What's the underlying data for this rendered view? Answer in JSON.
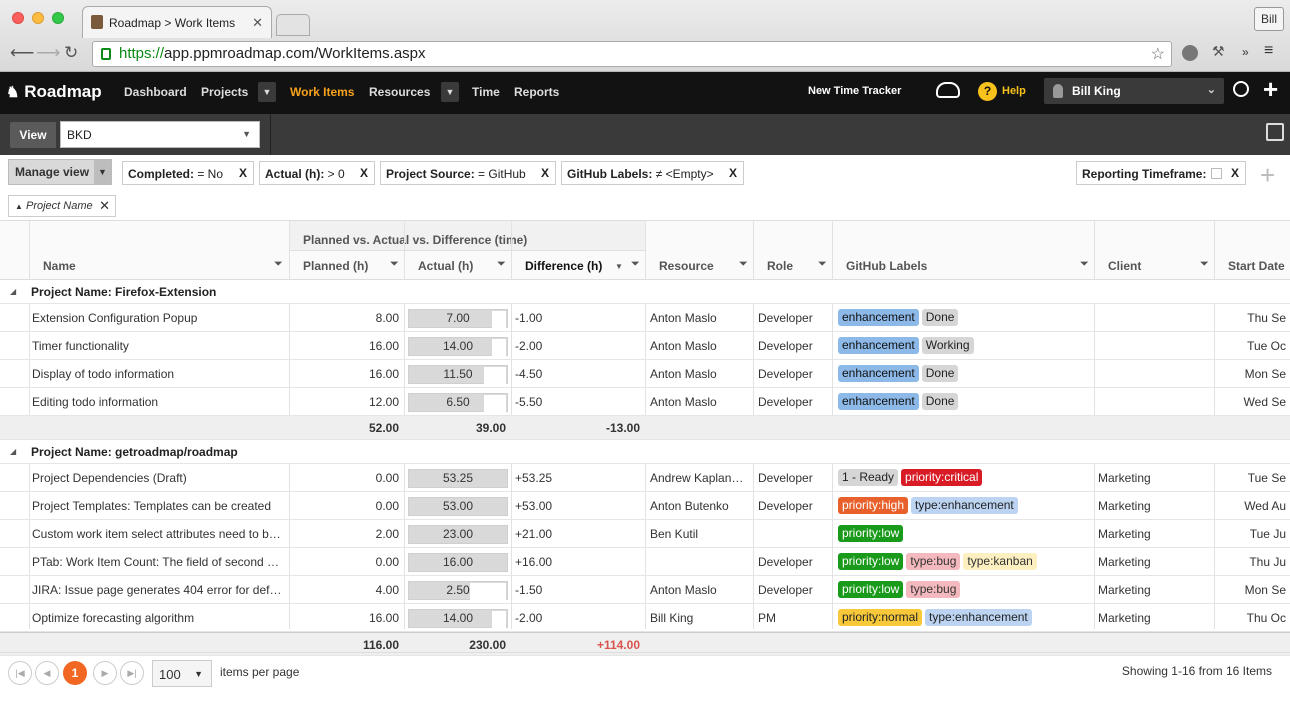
{
  "browser": {
    "tab_title": "Roadmap > Work Items",
    "url_scheme": "https://",
    "url_rest": "app.ppmroadmap.com/WorkItems.aspx",
    "profile": "Bill"
  },
  "nav": {
    "logo": "Roadmap",
    "items": [
      "Dashboard",
      "Projects",
      "Work Items",
      "Resources",
      "Time",
      "Reports"
    ],
    "active": "Work Items",
    "time_tracker": "New Time Tracker",
    "help": "Help",
    "user": "Bill King"
  },
  "view": {
    "label": "View",
    "selected": "BKD"
  },
  "filters": {
    "manage": "Manage view",
    "chips": [
      {
        "key": "Completed:",
        "val": " = No"
      },
      {
        "key": "Actual (h):",
        "val": " > 0"
      },
      {
        "key": "Project Source:",
        "val": " = GitHub"
      },
      {
        "key": "GitHub Labels:",
        "val": " ≠ <Empty>"
      }
    ],
    "reporting": "Reporting Timeframe:",
    "x": "X",
    "sort": "Project Name"
  },
  "grid": {
    "group_header": "Planned vs. Actual vs. Difference (time)",
    "columns": [
      "Name",
      "Planned (h)",
      "Actual (h)",
      "Difference (h)",
      "Resource",
      "Role",
      "GitHub Labels",
      "Client",
      "Start Date"
    ],
    "groups": [
      {
        "title": "Project Name: Firefox-Extension",
        "rows": [
          {
            "name": "Extension Configuration Popup",
            "planned": "8.00",
            "actual": "7.00",
            "actual_fill": 0.93,
            "diff": "-1.00",
            "resource": "Anton Maslo",
            "role": "Developer",
            "labels": [
              {
                "t": "enhancement",
                "c": "blue"
              },
              {
                "t": "Done",
                "c": "gray"
              }
            ],
            "client": "",
            "start": "Thu Se"
          },
          {
            "name": "Timer functionality",
            "planned": "16.00",
            "actual": "14.00",
            "actual_fill": 0.93,
            "diff": "-2.00",
            "resource": "Anton Maslo",
            "role": "Developer",
            "labels": [
              {
                "t": "enhancement",
                "c": "blue"
              },
              {
                "t": "Working",
                "c": "gray"
              }
            ],
            "client": "",
            "start": "Tue Oc"
          },
          {
            "name": "Display of todo information",
            "planned": "16.00",
            "actual": "11.50",
            "actual_fill": 0.78,
            "diff": "-4.50",
            "resource": "Anton Maslo",
            "role": "Developer",
            "labels": [
              {
                "t": "enhancement",
                "c": "blue"
              },
              {
                "t": "Done",
                "c": "gray"
              }
            ],
            "client": "",
            "start": "Mon Se"
          },
          {
            "name": "Editing todo information",
            "planned": "12.00",
            "actual": "6.50",
            "actual_fill": 0.78,
            "diff": "-5.50",
            "resource": "Anton Maslo",
            "role": "Developer",
            "labels": [
              {
                "t": "enhancement",
                "c": "blue"
              },
              {
                "t": "Done",
                "c": "gray"
              }
            ],
            "client": "",
            "start": "Wed Se"
          }
        ],
        "sum": {
          "planned": "52.00",
          "actual": "39.00",
          "diff": "-13.00"
        }
      },
      {
        "title": "Project Name: getroadmap/roadmap",
        "rows": [
          {
            "name": "Project Dependencies (Draft)",
            "planned": "0.00",
            "actual": "53.25",
            "actual_fill": 1,
            "diff": "+53.25",
            "resource": "Andrew Kaplan…",
            "role": "Developer",
            "labels": [
              {
                "t": "1 - Ready",
                "c": "gray"
              },
              {
                "t": "priority:critical",
                "c": "red"
              }
            ],
            "client": "Marketing",
            "start": "Tue Se"
          },
          {
            "name": "Project Templates: Templates can be created",
            "planned": "0.00",
            "actual": "53.00",
            "actual_fill": 1,
            "diff": "+53.00",
            "resource": "Anton Butenko",
            "role": "Developer",
            "labels": [
              {
                "t": "priority:high",
                "c": "orange"
              },
              {
                "t": "type:enhancement",
                "c": "lightblue"
              }
            ],
            "client": "Marketing",
            "start": "Wed Au"
          },
          {
            "name": "Custom work item select attributes need to b…",
            "planned": "2.00",
            "actual": "23.00",
            "actual_fill": 1,
            "diff": "+21.00",
            "resource": "Ben Kutil",
            "role": "",
            "labels": [
              {
                "t": "priority:low",
                "c": "green"
              }
            ],
            "client": "Marketing",
            "start": "Tue Ju"
          },
          {
            "name": "PTab: Work Item Count: The field of second …",
            "planned": "0.00",
            "actual": "16.00",
            "actual_fill": 1,
            "diff": "+16.00",
            "resource": "",
            "role": "Developer",
            "labels": [
              {
                "t": "priority:low",
                "c": "green"
              },
              {
                "t": "type:bug",
                "c": "pink"
              },
              {
                "t": "type:kanban",
                "c": "yellow"
              }
            ],
            "client": "Marketing",
            "start": "Thu Ju"
          },
          {
            "name": "JIRA: Issue page generates 404 error for def…",
            "planned": "4.00",
            "actual": "2.50",
            "actual_fill": 0.64,
            "diff": "-1.50",
            "resource": "Anton Maslo",
            "role": "Developer",
            "labels": [
              {
                "t": "priority:low",
                "c": "green"
              },
              {
                "t": "type:bug",
                "c": "pink"
              }
            ],
            "client": "Marketing",
            "start": "Mon Se"
          },
          {
            "name": "Optimize forecasting algorithm",
            "planned": "16.00",
            "actual": "14.00",
            "actual_fill": 0.88,
            "diff": "-2.00",
            "resource": "Bill King",
            "role": "PM",
            "labels": [
              {
                "t": "priority:normal",
                "c": "gold"
              },
              {
                "t": "type:enhancement",
                "c": "lightblue"
              }
            ],
            "client": "Marketing",
            "start": "Thu Oc"
          }
        ],
        "sum": {
          "planned": "",
          "actual": "",
          "diff": ""
        }
      }
    ],
    "total": {
      "planned": "116.00",
      "actual": "230.00",
      "diff": "+114.00"
    }
  },
  "pager": {
    "page": "1",
    "per_page": "100",
    "per_page_label": "items per page",
    "summary": "Showing 1-16 from 16 Items"
  },
  "colors": {
    "accent": "#f7a21b",
    "blue": "#8db9e8",
    "gray": "#d6d6d6",
    "red": "#d81b25",
    "orange": "#e8612c",
    "lightblue": "#bcd4f2",
    "green": "#1a9a1a",
    "pink": "#f4b9be",
    "yellow": "#fcefc0",
    "gold": "#f7c93a"
  }
}
